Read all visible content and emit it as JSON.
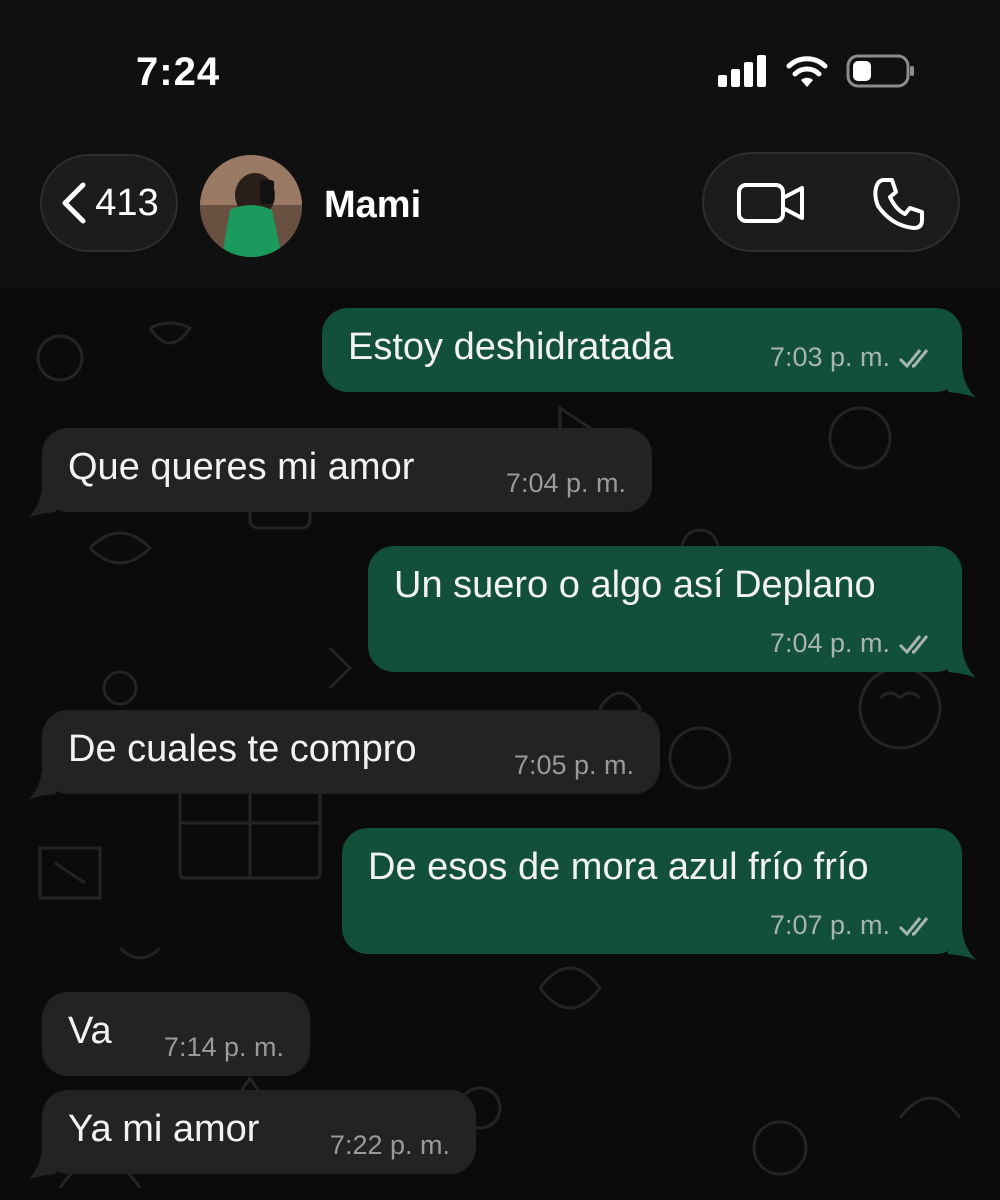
{
  "status_bar": {
    "time": "7:24",
    "icons": [
      "cellular-signal-icon",
      "wifi-icon",
      "battery-icon"
    ]
  },
  "header": {
    "back_count": "413",
    "contact_name": "Mami",
    "icons": [
      "chevron-left-icon",
      "video-call-icon",
      "phone-icon"
    ]
  },
  "colors": {
    "outgoing_bubble": "#12503a",
    "incoming_bubble": "#232323",
    "background": "#0b0b0b"
  },
  "messages": [
    {
      "direction": "outgoing",
      "text": "Estoy deshidratada",
      "time": "7:03 p. m.",
      "read": true
    },
    {
      "direction": "incoming",
      "text": "Que queres mi amor",
      "time": "7:04 p. m."
    },
    {
      "direction": "outgoing",
      "text": "Un suero o algo así Deplano",
      "time": "7:04 p. m.",
      "read": true
    },
    {
      "direction": "incoming",
      "text": "De cuales te compro",
      "time": "7:05 p. m."
    },
    {
      "direction": "outgoing",
      "text": "De esos de mora azul frío frío",
      "time": "7:07 p. m.",
      "read": true
    },
    {
      "direction": "incoming",
      "text": "Va",
      "time": "7:14 p. m."
    },
    {
      "direction": "incoming",
      "text": "Ya mi amor",
      "time": "7:22 p. m."
    }
  ]
}
